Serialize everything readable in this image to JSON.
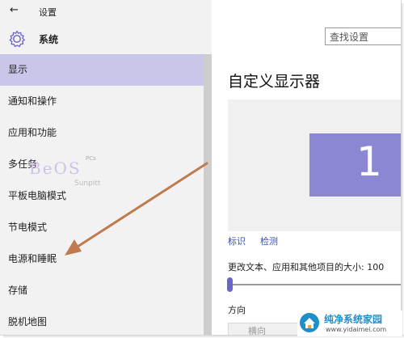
{
  "window": {
    "title": "设置"
  },
  "header": {
    "section": "系统",
    "search_placeholder": "查找设置"
  },
  "sidebar": {
    "items": [
      {
        "label": "显示"
      },
      {
        "label": "通知和操作"
      },
      {
        "label": "应用和功能"
      },
      {
        "label": "多任务"
      },
      {
        "label": "平板电脑模式"
      },
      {
        "label": "节电模式"
      },
      {
        "label": "电源和睡眠"
      },
      {
        "label": "存储"
      },
      {
        "label": "脱机地图"
      }
    ]
  },
  "main": {
    "title": "自定义显示器",
    "monitor_number": "1",
    "identify_link": "标识",
    "detect_link": "检测",
    "scale_label": "更改文本、应用和其他项目的大小: 100",
    "scale_fraction": 0.0,
    "orientation_label": "方向",
    "orientation_value": "横向"
  },
  "watermark": {
    "main": "BeOS",
    "sub": "Sunpitt",
    "pcs": "PCs"
  },
  "logo": {
    "name": "纯净系统家园",
    "url": "www.yidaimei.com"
  },
  "colors": {
    "accent": "#6a65c6",
    "selected_bg": "#c9c7e9",
    "monitor": "#8b87d2",
    "arrow": "#c07a4e"
  }
}
